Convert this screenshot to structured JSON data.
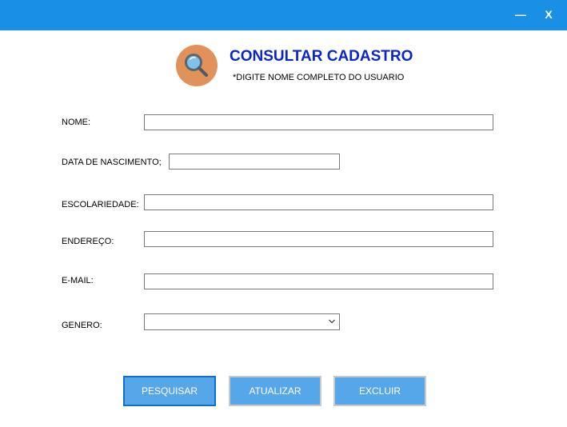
{
  "window": {
    "minimize_label": "—",
    "close_label": "X",
    "titlebar_color": "#1a8fe6"
  },
  "header": {
    "icon": "search-icon",
    "title": "CONSULTAR CADASTRO",
    "subtitle": "*DIGITE NOME COMPLETO DO USUARIO",
    "title_color": "#0a26c7"
  },
  "form": {
    "nome": {
      "label": "NOME:",
      "value": ""
    },
    "data_nascimento": {
      "label": "DATA DE NASCIMENTO;",
      "value": ""
    },
    "escolaridade": {
      "label": "ESCOLARIEDADE:",
      "value": ""
    },
    "endereco": {
      "label": "ENDEREÇO:",
      "value": ""
    },
    "email": {
      "label": "E-MAIL:",
      "value": ""
    },
    "genero": {
      "label": "GENERO:",
      "value": "",
      "icon": "chevron-down-icon"
    }
  },
  "actions": {
    "pesquisar": "PESQUISAR",
    "atualizar": "ATUALIZAR",
    "excluir": "EXCLUIR",
    "button_color": "#56a7ea"
  }
}
